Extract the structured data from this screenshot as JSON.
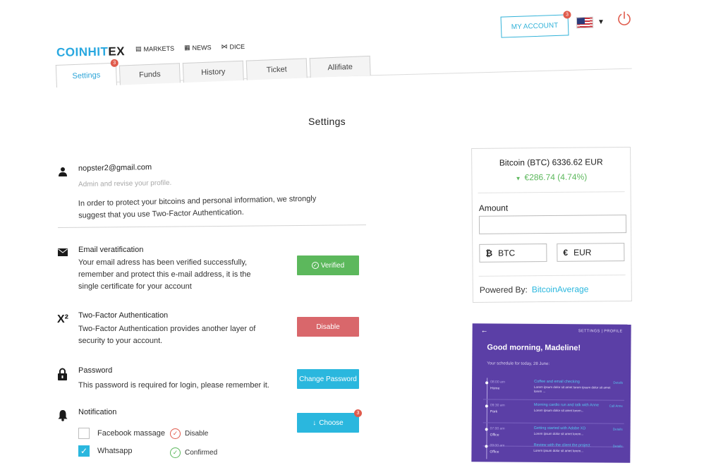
{
  "header": {
    "logo_part1": "COINHIT",
    "logo_part2": "EX",
    "nav": [
      {
        "label": "MARKETS",
        "icon": "markets-icon"
      },
      {
        "label": "NEWS",
        "icon": "news-icon"
      },
      {
        "label": "DICE",
        "icon": "dice-icon"
      }
    ],
    "account_label": "MY ACCOUNT",
    "account_badge": "3",
    "language_flag": "us-flag-icon"
  },
  "tabs": [
    {
      "label": "Settings",
      "active": true,
      "badge": "3"
    },
    {
      "label": "Funds"
    },
    {
      "label": "History"
    },
    {
      "label": "Ticket"
    },
    {
      "label": "Allifiate"
    }
  ],
  "page_title": "Settings",
  "profile": {
    "email": "nopster2@gmail.com",
    "subtitle": "Admin and revise your profile.",
    "text": "In order to protect your bitcoins and personal information, we strongly suggest that you use Two-Factor Authentication."
  },
  "settings": {
    "email": {
      "title": "Email veratification",
      "desc": "Your email adress has been verified successfully, remember and protect this e-mail address, it is the single certificate for your account",
      "button": "Verified"
    },
    "twofa": {
      "icon_text": "X²",
      "title": "Two-Factor Authentication",
      "desc": "Two-Factor Authentication provides another layer of security to your account.",
      "button": "Disable"
    },
    "password": {
      "title": "Password",
      "desc": "This password is required for login, please remember it.",
      "button": "Change Password"
    },
    "notification": {
      "title": "Notification",
      "button": "Choose",
      "button_badge": "3",
      "options": [
        {
          "label": "Facebook massage",
          "checked": false,
          "status": "Disable"
        },
        {
          "label": "Whatsapp",
          "checked": true,
          "status": "Confirmed"
        }
      ]
    }
  },
  "converter": {
    "price": "Bitcoin (BTC) 6336.62 EUR",
    "change": "€286.74 (4.74%)",
    "change_direction": "down",
    "amount_label": "Amount",
    "amount_value": "",
    "currencies": [
      {
        "symbol": "₿",
        "label": "BTC"
      },
      {
        "symbol": "€",
        "label": "EUR"
      }
    ],
    "powered_by_label": "Powered By:",
    "powered_by_link": "BitcoinAverage",
    "colors": {
      "positive": "#5cb85c",
      "link": "#2ab7de"
    }
  },
  "schedule": {
    "nav": "SETTINGS | PROFILE",
    "greeting": "Good morning, Madeline!",
    "subtitle": "Your schedule for today, 28 June:",
    "items": [
      {
        "time": "08:00 am",
        "place": "Home",
        "title": "Coffee and email checking",
        "desc": "Lorem ipsum dolor sit amet lorem ipsum dolor sit amet lorem ...",
        "action": "Details"
      },
      {
        "time": "09:30 am",
        "place": "Park",
        "title": "Morning cardio run and talk with Anne",
        "desc": "Lorem ipsum dolor sit amet lorem...",
        "action": "Call Anne"
      },
      {
        "time": "07:00 am",
        "place": "Office",
        "title": "Getting started with Adobe XD",
        "desc": "Lorem ipsum dolor sit amet lorem...",
        "action": "Details"
      },
      {
        "time": "09:00 am",
        "place": "Office",
        "title": "Review with the client the project",
        "desc": "Lorem ipsum dolor sit amet lorem...",
        "action": "Details"
      }
    ]
  },
  "colors": {
    "brand_blue": "#2ab7de",
    "success": "#5cb85c",
    "danger": "#d9676b",
    "badge": "#e05b4c",
    "schedule_bg": "#5b3fa6"
  }
}
